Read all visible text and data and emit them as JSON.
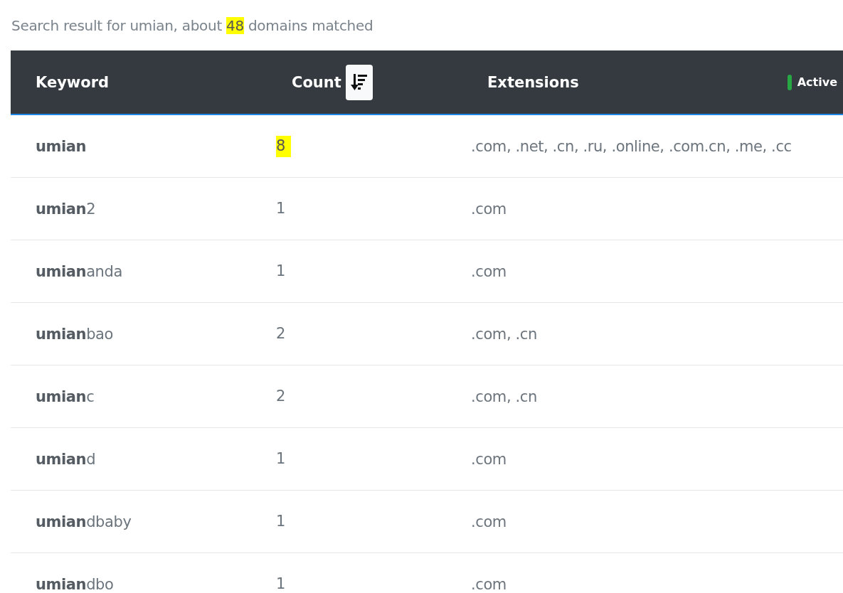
{
  "summary": {
    "before": "Search result for umian, about ",
    "highlight": "48",
    "after": " domains matched"
  },
  "table": {
    "columns": [
      {
        "label": "Keyword",
        "kind": "text"
      },
      {
        "label": "Count",
        "kind": "sort"
      },
      {
        "label": "Extensions",
        "kind": "text"
      }
    ],
    "status": {
      "label": "Active",
      "color": "#28a745"
    },
    "rows": [
      {
        "keyword": {
          "match": "umian"
        },
        "count": "8",
        "highlighted": true,
        "extensions": ".com, .net, .cn, .ru, .online, .com.cn, .me, .cc"
      },
      {
        "keyword": {
          "match": "umian",
          "rest": "2"
        },
        "count": "1",
        "highlighted": false,
        "extensions": ".com"
      },
      {
        "keyword": {
          "match": "umian",
          "rest": "anda"
        },
        "count": "1",
        "highlighted": false,
        "extensions": ".com"
      },
      {
        "keyword": {
          "match": "umian",
          "rest": "bao"
        },
        "count": "2",
        "highlighted": false,
        "extensions": ".com, .cn"
      },
      {
        "keyword": {
          "match": "umian",
          "rest": "c"
        },
        "count": "2",
        "highlighted": false,
        "extensions": ".com, .cn"
      },
      {
        "keyword": {
          "match": "umian",
          "rest": "d"
        },
        "count": "1",
        "highlighted": false,
        "extensions": ".com"
      },
      {
        "keyword": {
          "match": "umian",
          "rest": "dbaby"
        },
        "count": "1",
        "highlighted": false,
        "extensions": ".com"
      },
      {
        "keyword": {
          "match": "umian",
          "rest": "dbo"
        },
        "count": "1",
        "highlighted": false,
        "extensions": ".com"
      }
    ]
  }
}
